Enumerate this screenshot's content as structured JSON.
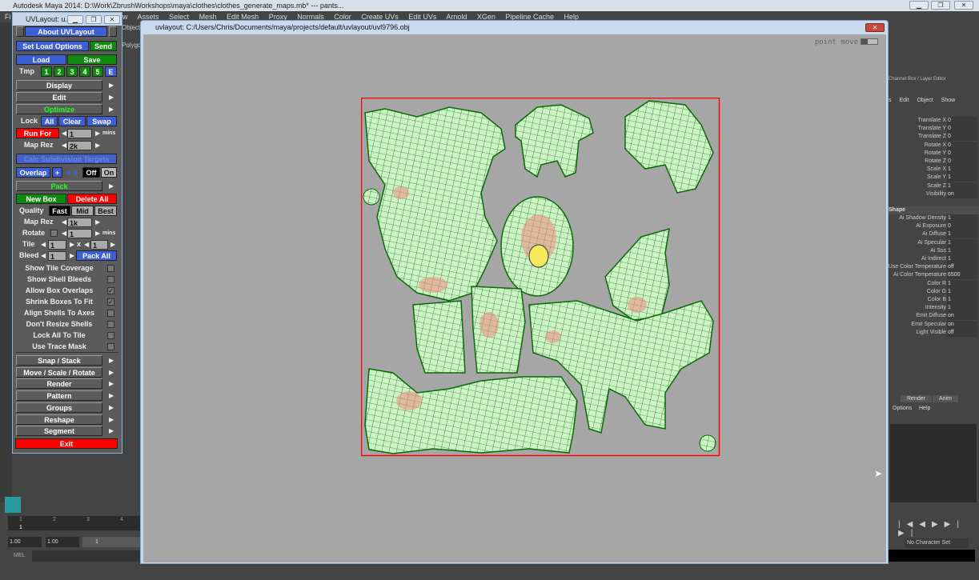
{
  "maya": {
    "title": "Autodesk Maya 2014: D:\\Work\\ZbrushWorkshops\\maya\\clothes\\clothes_generate_maps.mb*   ---   pants...",
    "menu": [
      "Fi",
      "low",
      "Assets",
      "Select",
      "Mesh",
      "Edit Mesh",
      "Proxy",
      "Normals",
      "Color",
      "Create UVs",
      "Edit UVs",
      "Arnold",
      "XGen",
      "Pipeline Cache",
      "Help"
    ],
    "shelf_tabs": [
      "Objects",
      "Polygon"
    ]
  },
  "uvpanel": {
    "title": "UVLayout: u...",
    "about": "About UVLayout",
    "set_load": "Set Load Options",
    "send": "Send",
    "load": "Load",
    "save": "Save",
    "tmp": "Tmp",
    "tmp_slots": [
      "1",
      "2",
      "3",
      "4",
      "5",
      "E"
    ],
    "display": "Display",
    "edit": "Edit",
    "optimize": "Optimize",
    "lock": "Lock",
    "lock_all": "All",
    "lock_clear": "Clear",
    "lock_swap": "Swap",
    "run_for": "Run For",
    "run_for_value": "1",
    "mins": "mins",
    "map_rez": "Map Rez",
    "map_rez_value": "2k",
    "calc": "Calc Subdivision Targets",
    "overlap": "Overlap",
    "plus": "+",
    "off": "Off",
    "on": "On",
    "pack": "Pack",
    "new_box": "New Box",
    "delete_all": "Delete All",
    "quality": "Quality",
    "fast": "Fast",
    "mid": "Mid",
    "best": "Best",
    "pack_map_rez": "Map Rez",
    "pack_map_rez_value": "1k",
    "rotate": "Rotate",
    "rotate_value": "1",
    "rotate_mins": "mins",
    "tile": "Tile",
    "tile_x": "1",
    "x": "x",
    "tile_y": "1",
    "bleed": "Bleed",
    "bleed_value": "1",
    "pack_all": "Pack All",
    "options": [
      {
        "label": "Show Tile Coverage",
        "checked": false
      },
      {
        "label": "Show Shell Bleeds",
        "checked": false
      },
      {
        "label": "Allow Box Overlaps",
        "checked": true
      },
      {
        "label": "Shrink Boxes To Fit",
        "checked": true
      },
      {
        "label": "Align Shells To Axes",
        "checked": false
      },
      {
        "label": "Don't Resize Shells",
        "checked": false
      },
      {
        "label": "Lock All To Tile",
        "checked": false
      },
      {
        "label": "Use Trace Mask",
        "checked": false
      }
    ],
    "sections": [
      "Snap / Stack",
      "Move / Scale / Rotate",
      "Render",
      "Pattern",
      "Groups",
      "Reshape",
      "Segment"
    ],
    "exit": "Exit"
  },
  "uvwin": {
    "title": "uvlayout: C:/Users/Chris/Documents/maya/projects/default/uvlayout/uvl9796.obj",
    "mode": "point move"
  },
  "channel_box": {
    "title": "Channel Box / Layer Editor",
    "menu": [
      "s",
      "Edit",
      "Object",
      "Show"
    ],
    "transform": [
      [
        "Translate X",
        "0"
      ],
      [
        "Translate Y",
        "0"
      ],
      [
        "Translate Z",
        "0"
      ],
      [
        "Rotate X",
        "0"
      ],
      [
        "Rotate Y",
        "0"
      ],
      [
        "Rotate Z",
        "0"
      ],
      [
        "Scale X",
        "1"
      ],
      [
        "Scale Y",
        "1"
      ],
      [
        "Scale Z",
        "1"
      ],
      [
        "Visibility",
        "on"
      ]
    ],
    "shape_header": "Shape",
    "shape": [
      [
        "Ai Shadow Density",
        "1"
      ],
      [
        "Ai Exposure",
        "0"
      ],
      [
        "Ai Diffuse",
        "1"
      ],
      [
        "Ai Specular",
        "1"
      ],
      [
        "Ai Sss",
        "1"
      ],
      [
        "Ai Indirect",
        "1"
      ],
      [
        "Use Color Temperature",
        "off"
      ],
      [
        "Ai Color Temperature",
        "6500"
      ],
      [
        "Color R",
        "1"
      ],
      [
        "Color G",
        "1"
      ],
      [
        "Color B",
        "1"
      ],
      [
        "Intensity",
        "1"
      ],
      [
        "Emit Diffuse",
        "on"
      ],
      [
        "Emit Specular",
        "on"
      ],
      [
        "Light Visible",
        "off"
      ]
    ]
  },
  "layer": {
    "tabs": [
      "Render",
      "Anim"
    ],
    "menu": [
      "Options",
      "Help"
    ]
  },
  "timeline": {
    "ticks": [
      "1",
      "2",
      "3",
      "4"
    ],
    "current": "1",
    "start": "1.00",
    "end": "1.00",
    "frame": "1",
    "character_set": "No Character Set",
    "mel": "MEL"
  },
  "colors": {
    "button_blue": "#3d5fd6",
    "button_green": "#0f8a0f",
    "button_red": "#ff0000",
    "shell_fill": "#c8f6c0",
    "shell_edge": "#0a6a0a",
    "tile_border": "#ff0000"
  }
}
